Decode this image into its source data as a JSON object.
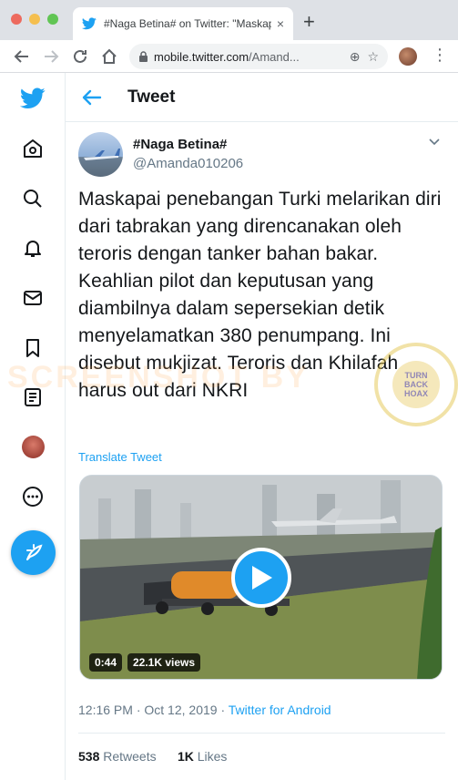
{
  "browser": {
    "tab_title": "#Naga Betina# on Twitter: \"Maskapai",
    "tab_close": "×",
    "new_tab": "+",
    "url_host": "mobile.twitter.com",
    "url_path": "/Amand...",
    "traffic_lights": [
      "#ed6a5e",
      "#f5bf4f",
      "#61c554"
    ]
  },
  "sidebar": {
    "items": [
      "home-icon",
      "explore-icon",
      "notifications-icon",
      "messages-icon",
      "bookmarks-icon",
      "lists-icon",
      "profile-avatar",
      "more-icon"
    ],
    "accent": "#1da1f2"
  },
  "header": {
    "title": "Tweet"
  },
  "tweet": {
    "author_name": "#Naga Betina#",
    "author_handle": "@Amanda010206",
    "text": "Maskapai penebangan Turki melarikan diri dari tabrakan yang direncanakan oleh teroris dengan tanker bahan bakar. Keahlian pilot dan keputusan yang diambilnya dalam sepersekian detik menyelamatkan 380 penumpang. Ini disebut mukjizat. Teroris dan Khilafah harus out dari NKRI",
    "translate_label": "Translate Tweet",
    "video_duration": "0:44",
    "video_views": "22.1K views",
    "time": "12:16 PM",
    "date": "Oct 12, 2019",
    "source": "Twitter for Android",
    "retweets_count": "538",
    "retweets_label": "Retweets",
    "likes_count": "1K",
    "likes_label": "Likes"
  },
  "watermark": {
    "text": "SCREENSHOT BY",
    "stamp_lines": [
      "TURN",
      "BACK",
      "HOAX"
    ]
  }
}
